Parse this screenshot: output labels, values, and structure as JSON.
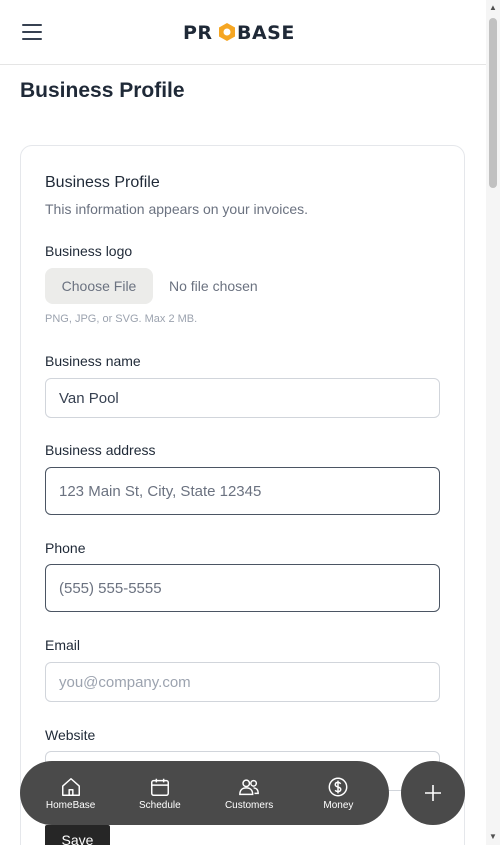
{
  "header": {
    "menu_icon": "hamburger-icon",
    "logo_text": "PROBASE"
  },
  "page": {
    "title": "Business Profile"
  },
  "card": {
    "title": "Business Profile",
    "subtitle": "This information appears on your invoices."
  },
  "form": {
    "logo": {
      "label": "Business logo",
      "button_label": "Choose File",
      "status": "No file chosen",
      "hint": "PNG, JPG, or SVG. Max 2 MB."
    },
    "name": {
      "label": "Business name",
      "value": "Van Pool"
    },
    "address": {
      "label": "Business address",
      "placeholder": "123 Main St, City, State 12345"
    },
    "phone": {
      "label": "Phone",
      "placeholder": "(555) 555-5555"
    },
    "email": {
      "label": "Email",
      "placeholder": "you@company.com"
    },
    "website": {
      "label": "Website",
      "placeholder": ""
    },
    "save_label": "Save"
  },
  "bottom_nav": {
    "items": [
      {
        "label": "HomeBase",
        "icon": "home-icon"
      },
      {
        "label": "Schedule",
        "icon": "calendar-icon"
      },
      {
        "label": "Customers",
        "icon": "users-icon"
      },
      {
        "label": "Money",
        "icon": "dollar-icon"
      }
    ],
    "fab_icon": "plus-icon"
  },
  "colors": {
    "brand_accent": "#f5a623",
    "nav_bg": "#4a4a4a",
    "save_bg": "#262626"
  }
}
